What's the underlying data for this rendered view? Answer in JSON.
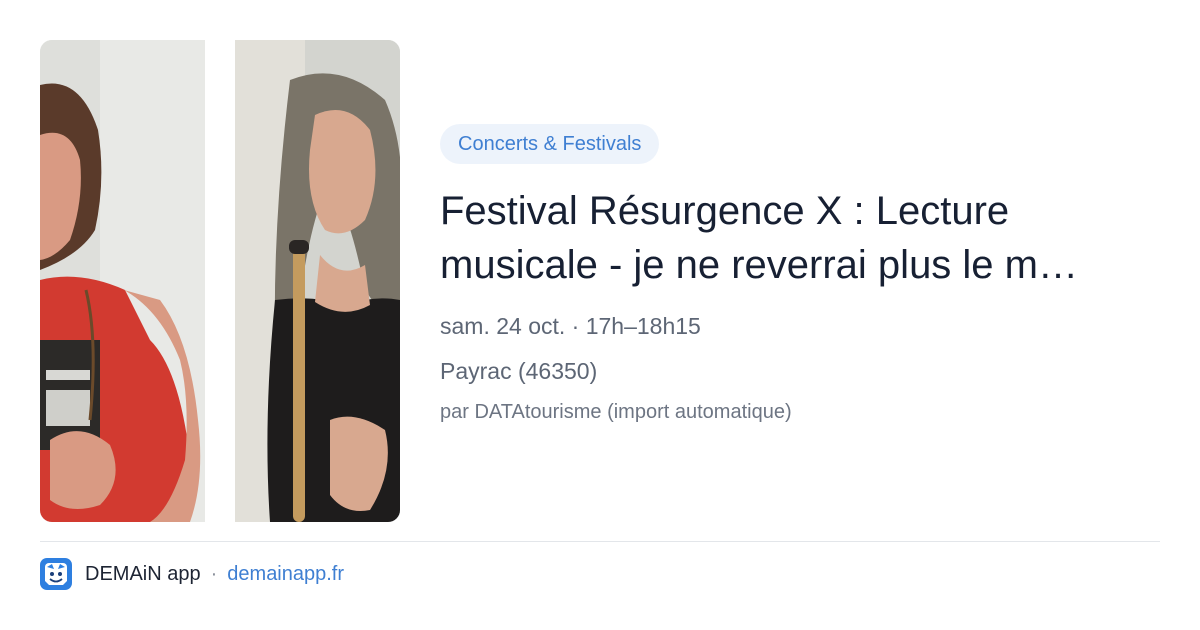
{
  "card": {
    "images": {
      "left": "portrait of a woman in a red top holding a book",
      "right": "portrait of a woman in black lace holding a wooden flute"
    }
  },
  "event": {
    "category": "Concerts & Festivals",
    "title_line1": "Festival Résurgence X : Lecture",
    "title_line2": "musicale - je ne reverrai plus le m…",
    "datetime": "sam. 24 oct. · 17h–18h15",
    "location": "Payrac (46350)",
    "source": "par DATAtourisme (import automatique)"
  },
  "footer": {
    "logo_icon": "demain-app-logo-icon",
    "app_name": "DEMAiN app",
    "separator": "·",
    "link": "demainapp.fr"
  },
  "colors": {
    "accent": "#3f7fd2",
    "badge_bg": "#edf3fb",
    "title": "#172033",
    "meta": "#5d6675"
  }
}
